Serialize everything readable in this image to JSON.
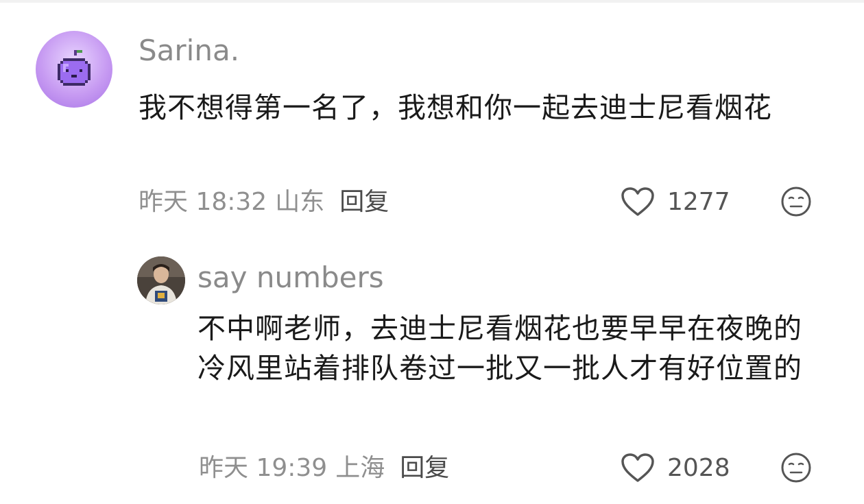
{
  "comments": [
    {
      "username": "Sarina.",
      "text": "我不想得第一名了，我想和你一起去迪士尼看烟花",
      "time": "昨天 18:32",
      "location": "山东",
      "reply_label": "回复",
      "likes": "1277"
    },
    {
      "username": "say numbers",
      "text": "不中啊老师，去迪士尼看烟花也要早早在夜晚的冷风里站着排队卷过一批又一批人才有好位置的",
      "time": "昨天 19:39",
      "location": "上海",
      "reply_label": "回复",
      "likes": "2028"
    }
  ],
  "icons": {
    "like": "heart-outline-icon",
    "reaction": "neutral-face-icon",
    "avatar_main": "purple-pixel-apple",
    "avatar_reply": "person-photo"
  },
  "colors": {
    "username": "#8a8a8a",
    "text": "#1a1a1a",
    "meta": "#8f8f8f",
    "reply": "#4a4a4a",
    "icon": "#555555",
    "avatar_bg": "#c79bf2"
  }
}
